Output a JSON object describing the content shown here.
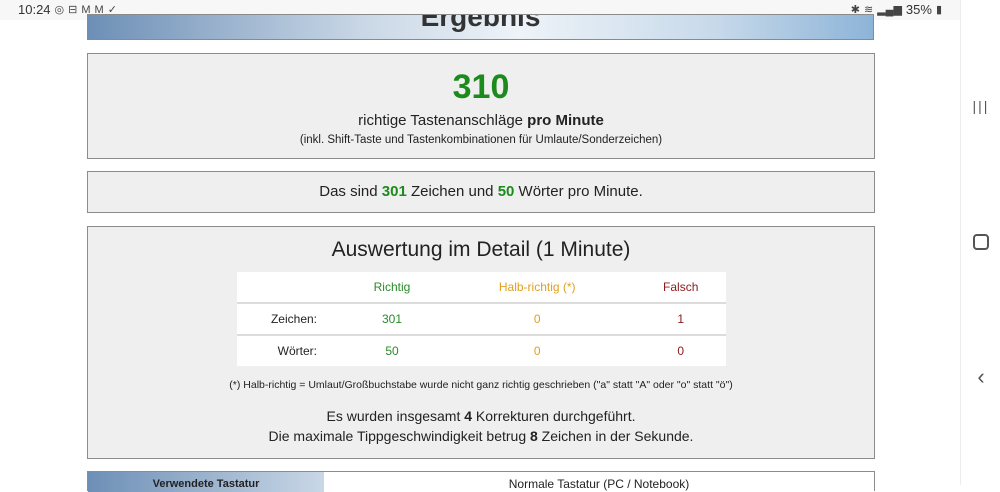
{
  "status_bar": {
    "time": "10:24",
    "battery": "35%"
  },
  "header": {
    "title": "Ergebnis"
  },
  "result": {
    "keystrokes": "310",
    "line_prefix": "richtige Tastenanschläge ",
    "line_bold": "pro Minute",
    "note": "(inkl. Shift-Taste und Tastenkombinationen für Umlaute/Sonderzeichen)"
  },
  "summary": {
    "prefix": "Das sind ",
    "chars": "301",
    "middle": " Zeichen und ",
    "words": "50",
    "suffix": " Wörter pro Minute."
  },
  "detail": {
    "title": "Auswertung im Detail (1 Minute)",
    "columns": [
      "Richtig",
      "Halb-richtig (*)",
      "Falsch"
    ],
    "rows": [
      {
        "label": "Zeichen:",
        "values": [
          "301",
          "0",
          "1"
        ]
      },
      {
        "label": "Wörter:",
        "values": [
          "50",
          "0",
          "0"
        ]
      }
    ],
    "footnote": "(*) Halb-richtig = Umlaut/Großbuchstabe wurde nicht ganz richtig geschrieben (\"a\" statt \"A\" oder \"o\" statt \"ö\")",
    "corrections_prefix": "Es wurden insgesamt ",
    "corrections_count": "4",
    "corrections_suffix": " Korrekturen durchgeführt.",
    "speed_prefix": "Die maximale Tippgeschwindigkeit betrug ",
    "speed_value": "8",
    "speed_suffix": " Zeichen in der Sekunde."
  },
  "bottom": {
    "left_label": "Verwendete Tastatur",
    "right_value": "Normale Tastatur (PC / Notebook)"
  },
  "colors": {
    "green": "#1d8a1d",
    "orange": "#e0a020",
    "red": "#8c1a1a"
  }
}
